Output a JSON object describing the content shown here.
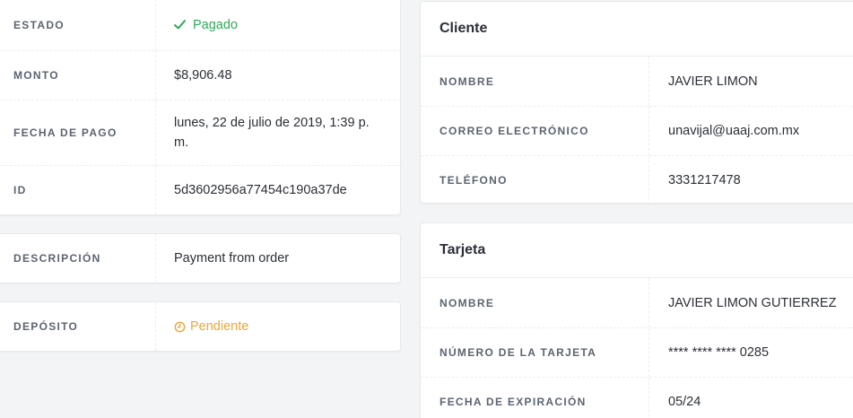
{
  "payment": {
    "status_label": "ESTADO",
    "status_value": "Pagado",
    "status_icon": "check-icon",
    "status_color": "#2eaa57",
    "amount_label": "MONTO",
    "amount_value": "$8,906.48",
    "date_label": "FECHA DE PAGO",
    "date_value": "lunes, 22 de julio de 2019, 1:39 p. m.",
    "id_label": "ID",
    "id_value": "5d3602956a77454c190a37de"
  },
  "description": {
    "label": "DESCRIPCIÓN",
    "value": "Payment from order"
  },
  "deposit": {
    "label": "DEPÓSITO",
    "value": "Pendiente",
    "icon": "clock-icon",
    "color": "#f0a43a"
  },
  "customer": {
    "title": "Cliente",
    "name_label": "NOMBRE",
    "name_value": "JAVIER LIMON",
    "email_label": "CORREO ELECTRÓNICO",
    "email_value": "unavijal@uaaj.com.mx",
    "phone_label": "TELÉFONO",
    "phone_value": "3331217478"
  },
  "card": {
    "title": "Tarjeta",
    "name_label": "NOMBRE",
    "name_value": "JAVIER LIMON GUTIERREZ",
    "number_label": "NÚMERO DE LA TARJETA",
    "number_value": "**** **** **** 0285",
    "expiry_label": "FECHA DE EXPIRACIÓN",
    "expiry_value": "05/24"
  }
}
